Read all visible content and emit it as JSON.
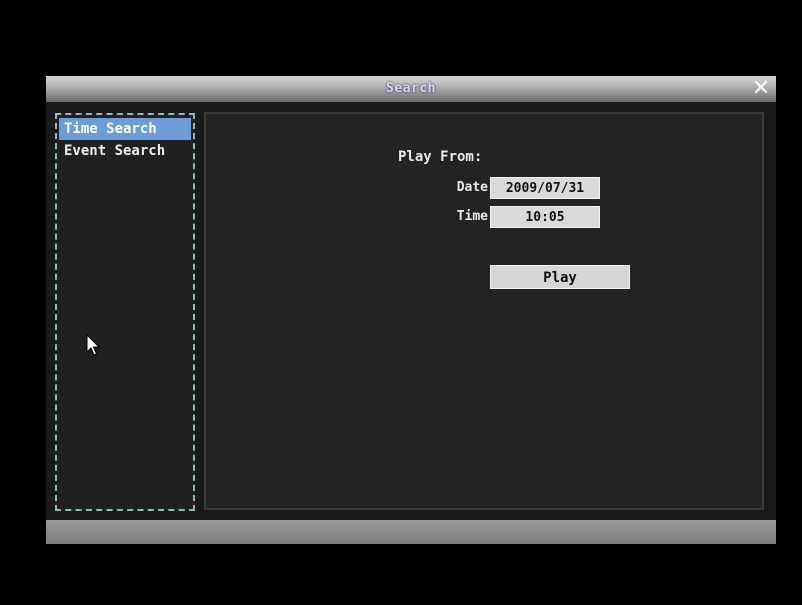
{
  "window": {
    "title": "Search",
    "close_label": "✕"
  },
  "sidebar": {
    "items": [
      {
        "label": "Time Search",
        "selected": true
      },
      {
        "label": "Event Search",
        "selected": false
      }
    ]
  },
  "content": {
    "section_label": "Play From:",
    "date": {
      "label": "Date",
      "value": "2009/07/31"
    },
    "time": {
      "label": "Time",
      "value": "10:05"
    },
    "play_label": "Play"
  },
  "colors": {
    "selected_item": "#6e9cd8",
    "sidebar_border": "#8fbcbc",
    "field_bg": "#d9d9d9"
  }
}
